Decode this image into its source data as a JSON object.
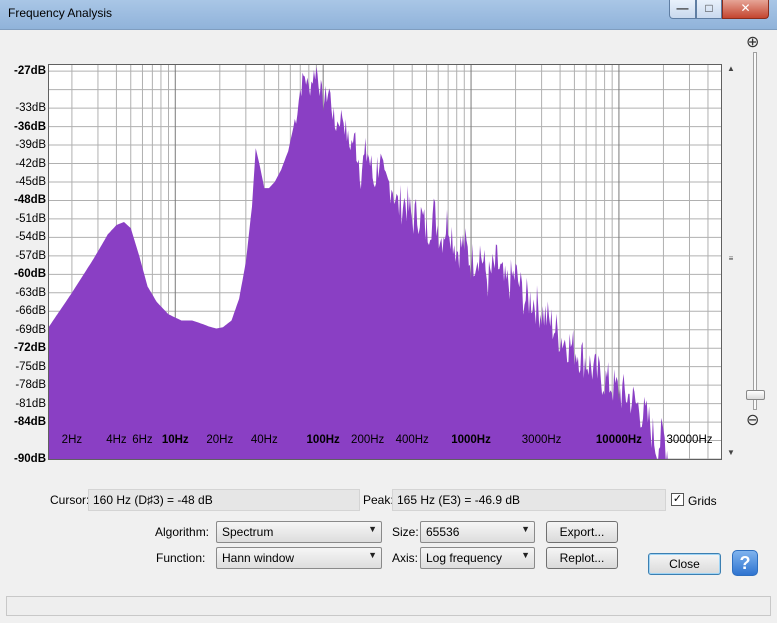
{
  "window": {
    "title": "Frequency Analysis",
    "minimize_glyph": "—",
    "maximize_glyph": "□",
    "close_glyph": "✕"
  },
  "plot": {
    "fill_color": "#8a3fc4",
    "grid_color": "#b0b0b0",
    "db_ticks": [
      {
        "label": "-27dB",
        "value": -27,
        "bold": true
      },
      {
        "label": "-33dB",
        "value": -33,
        "bold": false
      },
      {
        "label": "-36dB",
        "value": -36,
        "bold": true
      },
      {
        "label": "-39dB",
        "value": -39,
        "bold": false
      },
      {
        "label": "-42dB",
        "value": -42,
        "bold": false
      },
      {
        "label": "-45dB",
        "value": -45,
        "bold": false
      },
      {
        "label": "-48dB",
        "value": -48,
        "bold": true
      },
      {
        "label": "-51dB",
        "value": -51,
        "bold": false
      },
      {
        "label": "-54dB",
        "value": -54,
        "bold": false
      },
      {
        "label": "-57dB",
        "value": -57,
        "bold": false
      },
      {
        "label": "-60dB",
        "value": -60,
        "bold": true
      },
      {
        "label": "-63dB",
        "value": -63,
        "bold": false
      },
      {
        "label": "-66dB",
        "value": -66,
        "bold": false
      },
      {
        "label": "-69dB",
        "value": -69,
        "bold": false
      },
      {
        "label": "-72dB",
        "value": -72,
        "bold": true
      },
      {
        "label": "-75dB",
        "value": -75,
        "bold": false
      },
      {
        "label": "-78dB",
        "value": -78,
        "bold": false
      },
      {
        "label": "-81dB",
        "value": -81,
        "bold": false
      },
      {
        "label": "-84dB",
        "value": -84,
        "bold": true
      },
      {
        "label": "-90dB",
        "value": -90,
        "bold": true
      }
    ],
    "hz_ticks": [
      {
        "label": "2Hz",
        "value": 2,
        "bold": false
      },
      {
        "label": "4Hz",
        "value": 4,
        "bold": false
      },
      {
        "label": "6Hz",
        "value": 6,
        "bold": false
      },
      {
        "label": "10Hz",
        "value": 10,
        "bold": true
      },
      {
        "label": "20Hz",
        "value": 20,
        "bold": false
      },
      {
        "label": "40Hz",
        "value": 40,
        "bold": false
      },
      {
        "label": "100Hz",
        "value": 100,
        "bold": true
      },
      {
        "label": "200Hz",
        "value": 200,
        "bold": false
      },
      {
        "label": "400Hz",
        "value": 400,
        "bold": false
      },
      {
        "label": "1000Hz",
        "value": 1000,
        "bold": true
      },
      {
        "label": "3000Hz",
        "value": 3000,
        "bold": false
      },
      {
        "label": "10000Hz",
        "value": 10000,
        "bold": true
      },
      {
        "label": "30000Hz",
        "value": 30000,
        "bold": false
      }
    ],
    "db_range": [
      -90,
      -26
    ],
    "hz_range": [
      1.4,
      49000
    ],
    "spectrum": [
      [
        1.4,
        -68.5
      ],
      [
        2,
        -63
      ],
      [
        2.8,
        -57.5
      ],
      [
        3.5,
        -53.5
      ],
      [
        4.0,
        -52
      ],
      [
        4.5,
        -51.5
      ],
      [
        5.0,
        -52.5
      ],
      [
        5.7,
        -57
      ],
      [
        6.5,
        -62
      ],
      [
        7.5,
        -64.5
      ],
      [
        9,
        -66.5
      ],
      [
        11,
        -67.5
      ],
      [
        13,
        -67.5
      ],
      [
        15,
        -68
      ],
      [
        17,
        -68.5
      ],
      [
        19,
        -68.8
      ],
      [
        21,
        -68.6
      ],
      [
        24,
        -67.5
      ],
      [
        27,
        -64
      ],
      [
        30,
        -58
      ],
      [
        33,
        -49
      ],
      [
        35,
        -39.5
      ],
      [
        37,
        -42
      ],
      [
        40,
        -46
      ],
      [
        43,
        -46
      ],
      [
        47,
        -45
      ],
      [
        52,
        -43
      ],
      [
        58,
        -40
      ],
      [
        63,
        -36
      ],
      [
        67,
        -33
      ],
      [
        70,
        -30
      ],
      [
        75,
        -27.5
      ],
      [
        80,
        -30
      ],
      [
        85,
        -28
      ],
      [
        90,
        -26.5
      ],
      [
        100,
        -32
      ],
      [
        110,
        -30
      ],
      [
        120,
        -36
      ],
      [
        135,
        -34
      ],
      [
        150,
        -39
      ],
      [
        165,
        -38
      ],
      [
        180,
        -43
      ],
      [
        200,
        -40
      ],
      [
        220,
        -45
      ],
      [
        240,
        -41
      ],
      [
        260,
        -46
      ],
      [
        290,
        -45
      ],
      [
        320,
        -49
      ],
      [
        360,
        -48
      ],
      [
        400,
        -51
      ],
      [
        450,
        -50
      ],
      [
        500,
        -53
      ],
      [
        560,
        -50
      ],
      [
        630,
        -54
      ],
      [
        700,
        -51
      ],
      [
        800,
        -56
      ],
      [
        900,
        -55
      ],
      [
        1000,
        -58
      ],
      [
        1150,
        -56
      ],
      [
        1300,
        -61
      ],
      [
        1500,
        -58
      ],
      [
        1700,
        -62
      ],
      [
        2000,
        -60
      ],
      [
        2300,
        -64
      ],
      [
        2600,
        -64
      ],
      [
        3000,
        -66
      ],
      [
        3500,
        -68
      ],
      [
        4000,
        -70
      ],
      [
        5000,
        -72
      ],
      [
        6000,
        -74
      ],
      [
        7000,
        -76
      ],
      [
        8000,
        -77
      ],
      [
        10000,
        -79
      ],
      [
        12000,
        -80
      ],
      [
        14000,
        -82
      ],
      [
        16000,
        -84
      ],
      [
        18000,
        -88
      ],
      [
        20000,
        -86
      ],
      [
        22000,
        -90
      ],
      [
        23000,
        -90
      ]
    ]
  },
  "cursor": {
    "label": "Cursor:",
    "value": "160 Hz (D♯3) = -48 dB"
  },
  "peak": {
    "label": "Peak:",
    "value": "165 Hz (E3) = -46.9 dB"
  },
  "grids": {
    "label": "Grids",
    "checked": true,
    "check_glyph": "✓"
  },
  "controls": {
    "algorithm_label": "Algorithm:",
    "algorithm_value": "Spectrum",
    "size_label": "Size:",
    "size_value": "65536",
    "function_label": "Function:",
    "function_value": "Hann window",
    "axis_label": "Axis:",
    "axis_value": "Log frequency",
    "export_button": "Export...",
    "replot_button": "Replot...",
    "close_button": "Close",
    "help_glyph": "?",
    "dropdown_glyph": "▼"
  },
  "zoom": {
    "in_glyph": "⊕",
    "out_glyph": "⊖"
  },
  "scroll": {
    "up_glyph": "▲",
    "down_glyph": "▼",
    "thumb_glyph": "≡"
  }
}
